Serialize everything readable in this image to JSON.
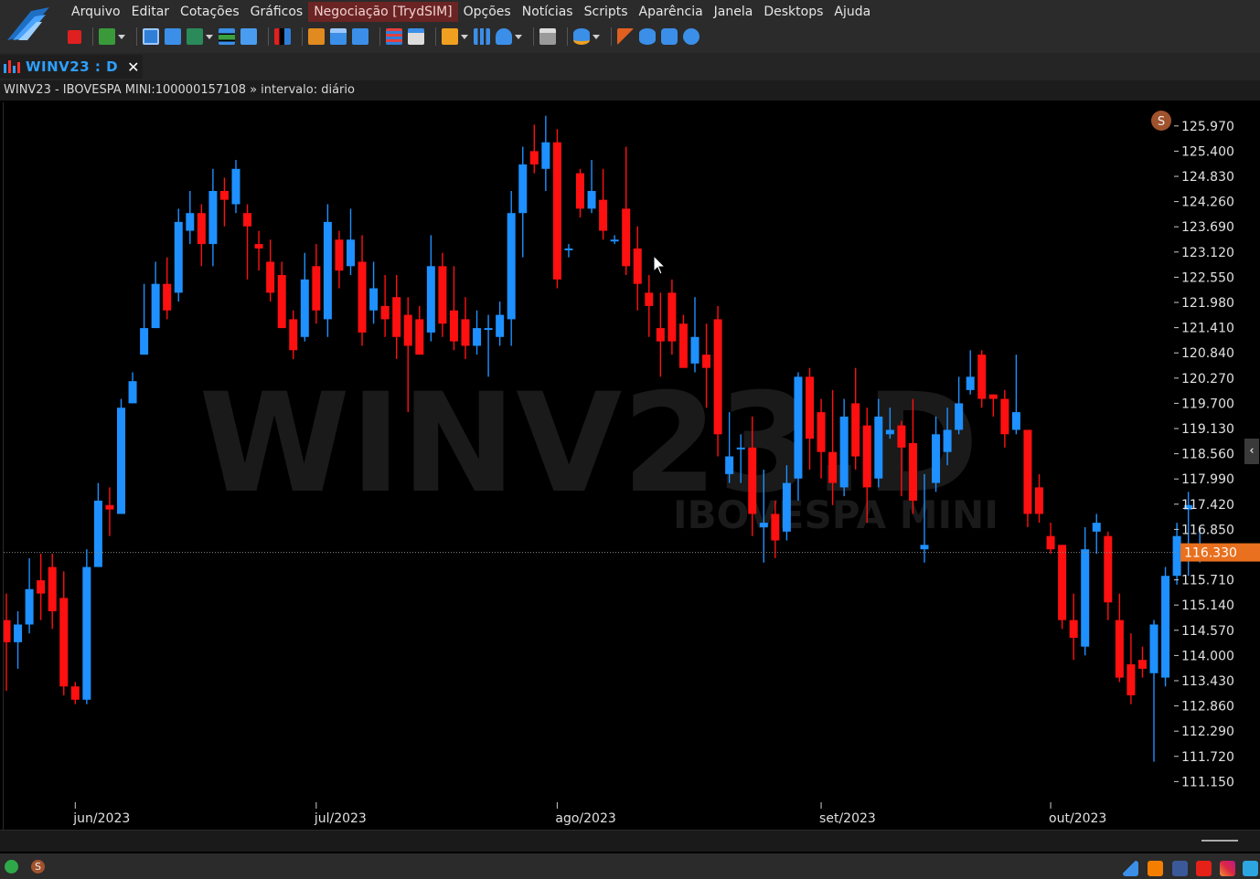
{
  "menu": {
    "items": [
      "Arquivo",
      "Editar",
      "Cotações",
      "Gráficos",
      "Negociação [TrydSIM]",
      "Opções",
      "Notícias",
      "Scripts",
      "Aparência",
      "Janela",
      "Desktops",
      "Ajuda"
    ]
  },
  "tab": {
    "title": "WINV23 : D",
    "close": "✕"
  },
  "info": {
    "text": "WINV23 - IBOVESPA MINI:100000157108 » intervalo: diário"
  },
  "colors": {
    "up": "#1e90ff",
    "down": "#ff1010",
    "price_tag": "#e8701e",
    "badge": "#a0522d"
  },
  "sim_badge": "S",
  "status": {
    "left_badge": "S"
  },
  "chart_data": {
    "type": "candlestick",
    "watermark_symbol": "WINV23.D",
    "watermark_name": "IBOVESPA MINI",
    "current_price": 116330,
    "current_price_label": "116.330",
    "y_ticks": [
      "125.970",
      "125.400",
      "124.830",
      "124.260",
      "123.690",
      "123.120",
      "122.550",
      "121.980",
      "121.410",
      "120.840",
      "120.270",
      "119.700",
      "119.130",
      "118.560",
      "117.990",
      "117.420",
      "116.850",
      "115.710",
      "115.140",
      "114.570",
      "114.000",
      "113.430",
      "112.860",
      "112.290",
      "111.720",
      "111.150"
    ],
    "ylim": [
      110600,
      126400
    ],
    "x_labels": [
      {
        "label": "jun/2023",
        "bar": 6
      },
      {
        "label": "jul/2023",
        "bar": 27
      },
      {
        "label": "ago/2023",
        "bar": 48
      },
      {
        "label": "set/2023",
        "bar": 71
      },
      {
        "label": "out/2023",
        "bar": 91
      }
    ],
    "candles": [
      [
        114800,
        114300,
        115400,
        113200
      ],
      [
        114300,
        114700,
        115000,
        113700
      ],
      [
        114700,
        115500,
        116200,
        114500
      ],
      [
        115700,
        115400,
        116300,
        114800
      ],
      [
        116000,
        115000,
        116300,
        114600
      ],
      [
        115300,
        113300,
        115900,
        113100
      ],
      [
        113300,
        113000,
        113400,
        112900
      ],
      [
        113000,
        116000,
        116400,
        112900
      ],
      [
        116000,
        117500,
        117900,
        116000
      ],
      [
        117400,
        117300,
        117800,
        116700
      ],
      [
        117200,
        119600,
        119800,
        117200
      ],
      [
        119700,
        120200,
        120400,
        119700
      ],
      [
        120800,
        121400,
        122400,
        120800
      ],
      [
        121400,
        122400,
        122900,
        121400
      ],
      [
        122400,
        121800,
        123000,
        121600
      ],
      [
        122200,
        123800,
        124100,
        122000
      ],
      [
        123600,
        124000,
        124500,
        123300
      ],
      [
        124000,
        123300,
        124200,
        122800
      ],
      [
        123300,
        124500,
        125000,
        122800
      ],
      [
        124500,
        124300,
        124800,
        123700
      ],
      [
        124200,
        125000,
        125200,
        124000
      ],
      [
        124000,
        123700,
        124200,
        122500
      ],
      [
        123300,
        123200,
        123600,
        122700
      ],
      [
        122900,
        122200,
        123400,
        122000
      ],
      [
        122600,
        121400,
        122900,
        121400
      ],
      [
        121600,
        120900,
        121800,
        120700
      ],
      [
        121200,
        122500,
        123100,
        121100
      ],
      [
        122800,
        121800,
        123300,
        121500
      ],
      [
        121600,
        123800,
        124200,
        121200
      ],
      [
        123400,
        122700,
        123600,
        122300
      ],
      [
        122800,
        123400,
        124100,
        122600
      ],
      [
        122900,
        121300,
        123500,
        121000
      ],
      [
        121800,
        122300,
        122900,
        121500
      ],
      [
        121900,
        121600,
        122600,
        121200
      ],
      [
        122100,
        121200,
        122600,
        120700
      ],
      [
        121700,
        121000,
        122100,
        119500
      ],
      [
        121600,
        120800,
        121900,
        120800
      ],
      [
        121300,
        122800,
        123500,
        121100
      ],
      [
        122800,
        121500,
        123100,
        121200
      ],
      [
        121800,
        121100,
        122800,
        120900
      ],
      [
        121600,
        121000,
        122100,
        120700
      ],
      [
        121000,
        121400,
        121800,
        120800
      ],
      [
        121400,
        121400,
        121700,
        120300
      ],
      [
        121200,
        121700,
        122000,
        121000
      ],
      [
        121600,
        124000,
        124500,
        121000
      ],
      [
        124000,
        125100,
        125500,
        123000
      ],
      [
        125400,
        125100,
        126000,
        124900
      ],
      [
        125000,
        125600,
        126200,
        124500
      ],
      [
        125600,
        122500,
        125900,
        122300
      ],
      [
        123200,
        123200,
        123300,
        123000
      ],
      [
        124900,
        124100,
        125000,
        123900
      ],
      [
        124100,
        124500,
        125200,
        124000
      ],
      [
        124300,
        123600,
        125000,
        123400
      ],
      [
        123400,
        123400,
        123500,
        123300
      ],
      [
        124100,
        122800,
        125500,
        122600
      ],
      [
        123200,
        122400,
        123700,
        121800
      ],
      [
        122200,
        121900,
        122600,
        121200
      ],
      [
        121400,
        121100,
        122200,
        120300
      ],
      [
        122200,
        121100,
        122500,
        120800
      ],
      [
        121500,
        120500,
        121700,
        120500
      ],
      [
        120600,
        121200,
        122100,
        120400
      ],
      [
        120800,
        120500,
        121500,
        119600
      ],
      [
        121600,
        119000,
        121900,
        118500
      ],
      [
        118100,
        118500,
        119500,
        117900
      ],
      [
        118700,
        118700,
        119000,
        117900
      ],
      [
        118700,
        117200,
        119400,
        116700
      ],
      [
        116900,
        117000,
        118200,
        116100
      ],
      [
        117200,
        116600,
        117500,
        116200
      ],
      [
        116800,
        117900,
        118300,
        116600
      ],
      [
        118000,
        120300,
        120400,
        117500
      ],
      [
        120300,
        118900,
        120500,
        118200
      ],
      [
        119500,
        118600,
        119800,
        118000
      ],
      [
        118600,
        117900,
        120000,
        117400
      ],
      [
        117800,
        119400,
        119800,
        117600
      ],
      [
        119700,
        118500,
        120500,
        118200
      ],
      [
        119200,
        117800,
        119600,
        117000
      ],
      [
        118000,
        119400,
        119800,
        117800
      ],
      [
        119000,
        119100,
        119600,
        118900
      ],
      [
        119200,
        118700,
        119300,
        117600
      ],
      [
        118800,
        117500,
        119800,
        117200
      ],
      [
        116400,
        116500,
        118100,
        116100
      ],
      [
        117900,
        119000,
        119400,
        117700
      ],
      [
        118600,
        119100,
        119600,
        118300
      ],
      [
        119100,
        119700,
        120300,
        119000
      ],
      [
        120000,
        120300,
        120900,
        119900
      ],
      [
        120800,
        119800,
        120900,
        119600
      ],
      [
        119900,
        119800,
        119900,
        119400
      ],
      [
        119800,
        119000,
        120000,
        118700
      ],
      [
        119100,
        119500,
        120800,
        119000
      ],
      [
        119100,
        117200,
        119100,
        116900
      ],
      [
        117800,
        117200,
        118100,
        117000
      ],
      [
        116700,
        116400,
        117000,
        116300
      ],
      [
        116500,
        114800,
        116500,
        114600
      ],
      [
        114800,
        114400,
        115400,
        113900
      ],
      [
        114200,
        116400,
        116900,
        114000
      ],
      [
        116800,
        117000,
        117200,
        116300
      ],
      [
        116700,
        115200,
        116800,
        114800
      ],
      [
        114800,
        113500,
        115400,
        113400
      ],
      [
        113800,
        113100,
        114500,
        112900
      ],
      [
        113900,
        113700,
        114200,
        113500
      ],
      [
        113600,
        114700,
        114800,
        111600
      ],
      [
        113500,
        115800,
        116000,
        113300
      ],
      [
        115800,
        116700,
        117000,
        115600
      ],
      [
        117300,
        117400,
        117700,
        115800
      ],
      [
        116300,
        116300,
        116900,
        116100
      ]
    ]
  }
}
